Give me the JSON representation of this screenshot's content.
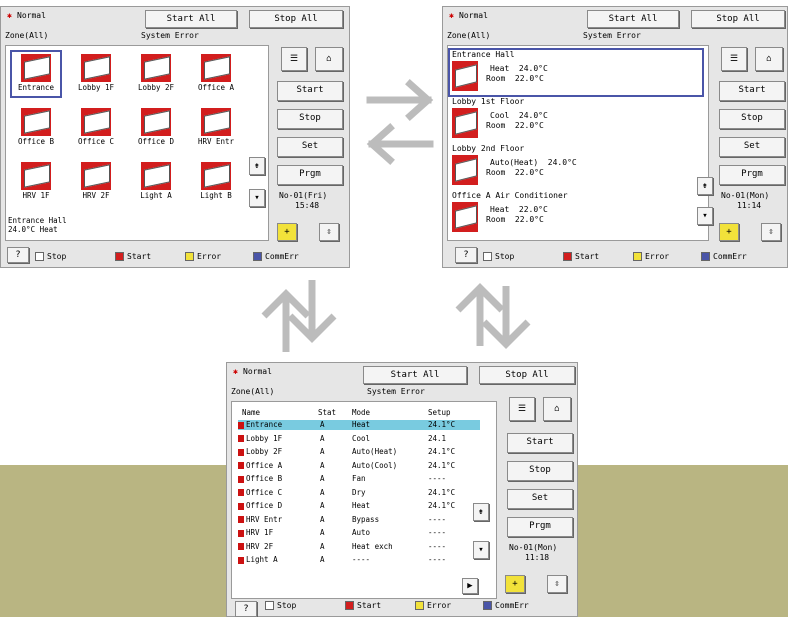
{
  "common": {
    "mode": "Normal",
    "start_all": "Start All",
    "stop_all": "Stop All",
    "zone": "Zone(All)",
    "system_error": "System Error",
    "buttons": {
      "start": "Start",
      "stop": "Stop",
      "set": "Set",
      "prgm": "Prgm"
    },
    "help": "?",
    "legend": [
      {
        "label": "Stop",
        "color": "#ffffff"
      },
      {
        "label": "Start",
        "color": "#d21e1e"
      },
      {
        "label": "Error",
        "color": "#f2e23a"
      },
      {
        "label": "CommErr",
        "color": "#4a55a8"
      }
    ],
    "colors": {
      "band": "#b9b582",
      "icon_bg": "#d21e1e",
      "highlight": "#79cbe0",
      "arrows": "#bcbcbc"
    }
  },
  "icon_screen": {
    "units": [
      "Entrance",
      "Lobby 1F",
      "Lobby 2F",
      "Office A",
      "Office B",
      "Office C",
      "Office D",
      "HRV Entr",
      "HRV 1F",
      "HRV 2F",
      "Light A",
      "Light B"
    ],
    "selected_name": "Entrance Hall",
    "selected_status": "24.0°C  Heat",
    "clock_date": "No-01(Fri)",
    "clock_time": "15:48"
  },
  "detail_screen": {
    "entries": [
      {
        "name": "Entrance Hall",
        "line1": "Heat  24.0°C",
        "line2": "Room  22.0°C"
      },
      {
        "name": "Lobby 1st Floor",
        "line1": "Cool  24.0°C",
        "line2": "Room  22.0°C"
      },
      {
        "name": "Lobby 2nd Floor",
        "line1": "Auto(Heat)  24.0°C",
        "line2": "Room  22.0°C"
      },
      {
        "name": "Office A Air Conditioner",
        "line1": "Heat  22.0°C",
        "line2": "Room  22.0°C"
      }
    ],
    "clock_date": "No-01(Mon)",
    "clock_time": "11:14"
  },
  "list_screen": {
    "columns": [
      "Name",
      "Stat",
      "Mode",
      "Setup"
    ],
    "rows": [
      [
        "Entrance",
        "A",
        "Heat",
        "24.1°C"
      ],
      [
        "Lobby 1F",
        "A",
        "Cool",
        "24.1"
      ],
      [
        "Lobby 2F",
        "A",
        "Auto(Heat)",
        "24.1°C"
      ],
      [
        "Office A",
        "A",
        "Auto(Cool)",
        "24.1°C"
      ],
      [
        "Office B",
        "A",
        "Fan",
        "----"
      ],
      [
        "Office C",
        "A",
        "Dry",
        "24.1°C"
      ],
      [
        "Office D",
        "A",
        "Heat",
        "24.1°C"
      ],
      [
        "HRV Entr",
        "A",
        "Bypass",
        "----"
      ],
      [
        "HRV 1F",
        "A",
        "Auto",
        "----"
      ],
      [
        "HRV 2F",
        "A",
        "Heat exch",
        "----"
      ],
      [
        "Light A",
        "A",
        "----",
        "----"
      ]
    ],
    "clock_date": "No-01(Mon)",
    "clock_time": "11:18"
  }
}
